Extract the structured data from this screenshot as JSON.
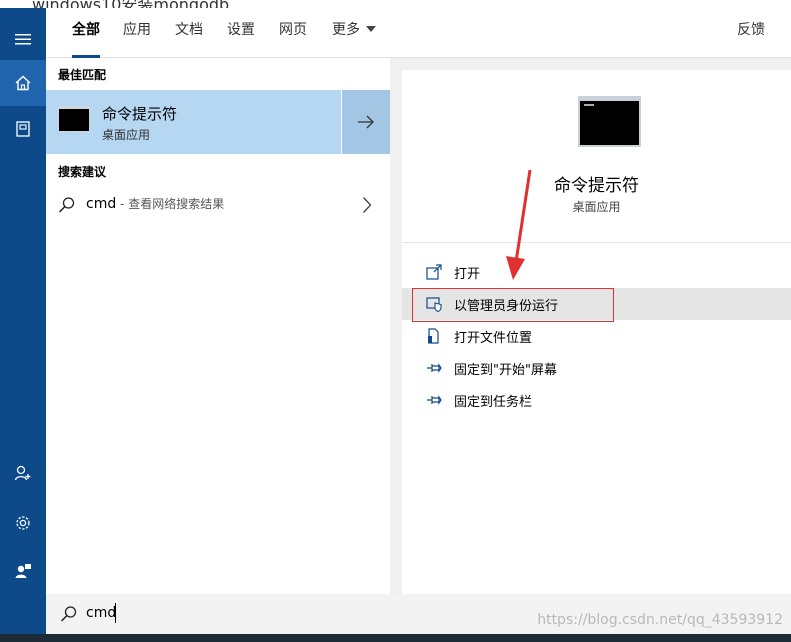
{
  "window": {
    "behind_title": "windows10安装mongodb"
  },
  "tabs": [
    {
      "label": "全部",
      "active": true
    },
    {
      "label": "应用"
    },
    {
      "label": "文档"
    },
    {
      "label": "设置"
    },
    {
      "label": "网页"
    },
    {
      "label": "更多"
    }
  ],
  "feedback_label": "反馈",
  "sidebar": {
    "icons": [
      "menu-icon",
      "home-icon",
      "notebook-icon",
      "person-add-icon",
      "gear-icon",
      "feedback-person-icon"
    ],
    "accent": "#0e4a8a"
  },
  "best_match": {
    "section_title": "最佳匹配",
    "name": "命令提示符",
    "subtitle": "桌面应用"
  },
  "suggestions": {
    "section_title": "搜索建议",
    "item_query": "cmd",
    "item_hint": " - 查看网络搜索结果"
  },
  "detail": {
    "app_name": "命令提示符",
    "app_subtitle": "桌面应用",
    "actions": [
      {
        "label": "打开",
        "icon": "open-icon"
      },
      {
        "label": "以管理员身份运行",
        "icon": "shield-icon",
        "highlighted": true
      },
      {
        "label": "打开文件位置",
        "icon": "file-location-icon"
      },
      {
        "label": "固定到\"开始\"屏幕",
        "icon": "pin-icon"
      },
      {
        "label": "固定到任务栏",
        "icon": "pin-icon"
      }
    ]
  },
  "search": {
    "value": "cmd"
  },
  "watermark": "https://blog.csdn.net/qq_43593912",
  "colors": {
    "selection": "#b5d7f2",
    "annotation_red": "#e03030"
  }
}
